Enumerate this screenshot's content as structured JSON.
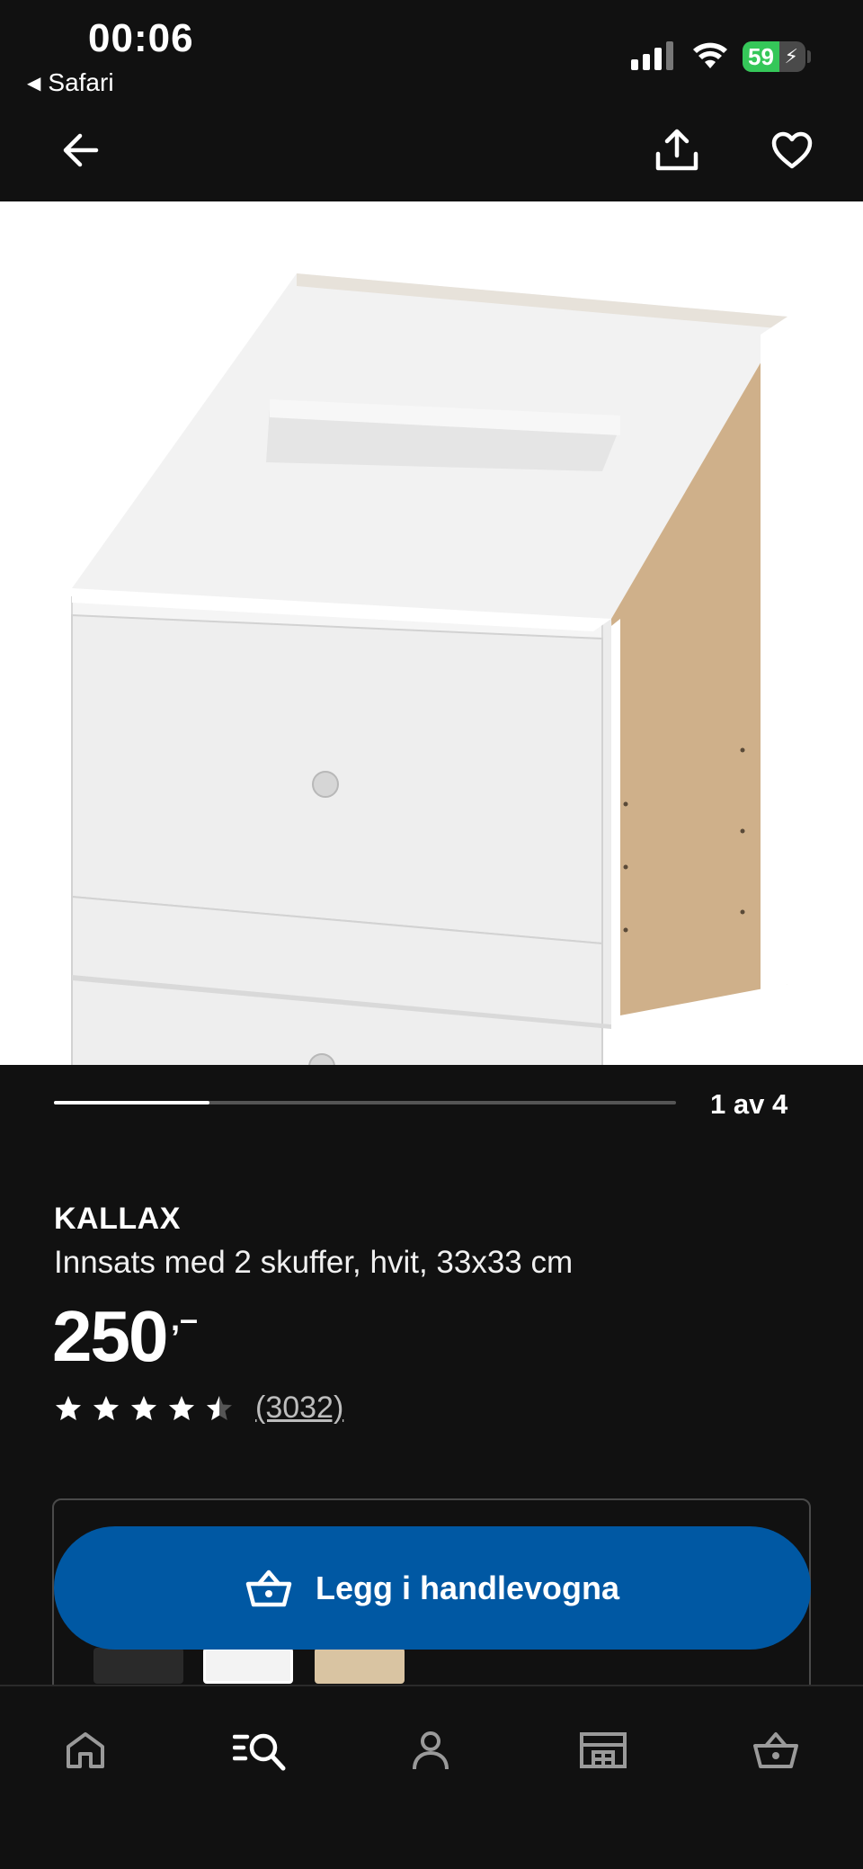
{
  "status_bar": {
    "time": "00:06",
    "back_app": "Safari",
    "battery_level": "59",
    "battery_fraction": 0.59
  },
  "nav": {
    "back_icon": "arrow-left-icon",
    "share_icon": "share-icon",
    "favorite_icon": "heart-icon"
  },
  "gallery": {
    "pager_label": "1 av 4",
    "current": 1,
    "total": 4
  },
  "product": {
    "brand": "KALLAX",
    "description": "Innsats med 2 skuffer, hvit, 33x33 cm",
    "price": "250",
    "price_suffix": ",–",
    "rating_value": 4.5,
    "rating_max": 5,
    "rating_count": "(3032)"
  },
  "cta": {
    "label": "Legg i handlevogna",
    "icon": "shopping-basket-icon",
    "color": "#0058a3"
  },
  "variants": {
    "thumbs": [
      "black-brown",
      "white",
      "white-oak"
    ]
  },
  "tabbar": {
    "items": [
      "home-icon",
      "search-list-icon",
      "profile-icon",
      "store-icon",
      "basket-icon"
    ]
  },
  "colors": {
    "background": "#111111",
    "accent": "#0058a3"
  }
}
